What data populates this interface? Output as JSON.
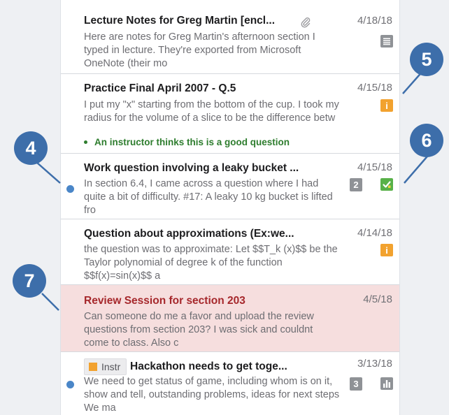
{
  "posts": [
    {
      "title": "Lecture Notes for Greg Martin [encl...",
      "excerpt": "Here are notes for Greg Martin's afternoon section I typed in lecture. They're exported from Microsoft OneNote (their mo",
      "date": "4/18/18",
      "type_icon": "note-icon",
      "has_attachment": true
    },
    {
      "title": "Practice Final April 2007 - Q.5",
      "excerpt": "I put my \"x\" starting from the bottom of the cup. I took my radius for the volume of a slice to be the difference betw",
      "endorsement": "An instructor thinks this is a good question",
      "date": "4/15/18",
      "type_icon": "unanswered-question-icon",
      "type_glyph": "i"
    },
    {
      "title": "Work question involving a leaky bucket ...",
      "excerpt": "In section 6.4, I came across a question where I had quite a bit of difficulty. #17: A leaky 10 kg bucket is lifted fro",
      "date": "4/15/18",
      "unread": true,
      "count": "2",
      "type_icon": "answered-question-icon"
    },
    {
      "title": "Question about approximations (Ex:we...",
      "excerpt": "the question was to approximate: Let $$T_k (x)$$ be the Taylor polynomial of degree k of the function $$f(x)=sin(x)$$ a",
      "date": "4/14/18",
      "type_icon": "unanswered-question-icon",
      "type_glyph": "i"
    },
    {
      "title": "Review Session for section 203",
      "excerpt": "Can someone do me a favor and upload the review questions from section 203? I was sick and couldnt come to class. Also c",
      "date": "4/5/18",
      "highlighted": true
    },
    {
      "tag": "Instr",
      "title": "Hackathon needs to get toge...",
      "excerpt": "We need to get status of game, including whom is on it, show and tell, outstanding problems, ideas for next steps We ma",
      "date": "3/13/18",
      "unread": true,
      "count": "3",
      "type_icon": "poll-icon"
    }
  ],
  "callouts": [
    "4",
    "5",
    "6",
    "7"
  ],
  "colors": {
    "accent": "#3d6eaa",
    "unread": "#4a86c8",
    "question": "#f2a22f",
    "answered": "#58b148",
    "highlight_bg": "#f6dede",
    "highlight_title": "#a6282c",
    "endorsement": "#2e7d2e"
  }
}
